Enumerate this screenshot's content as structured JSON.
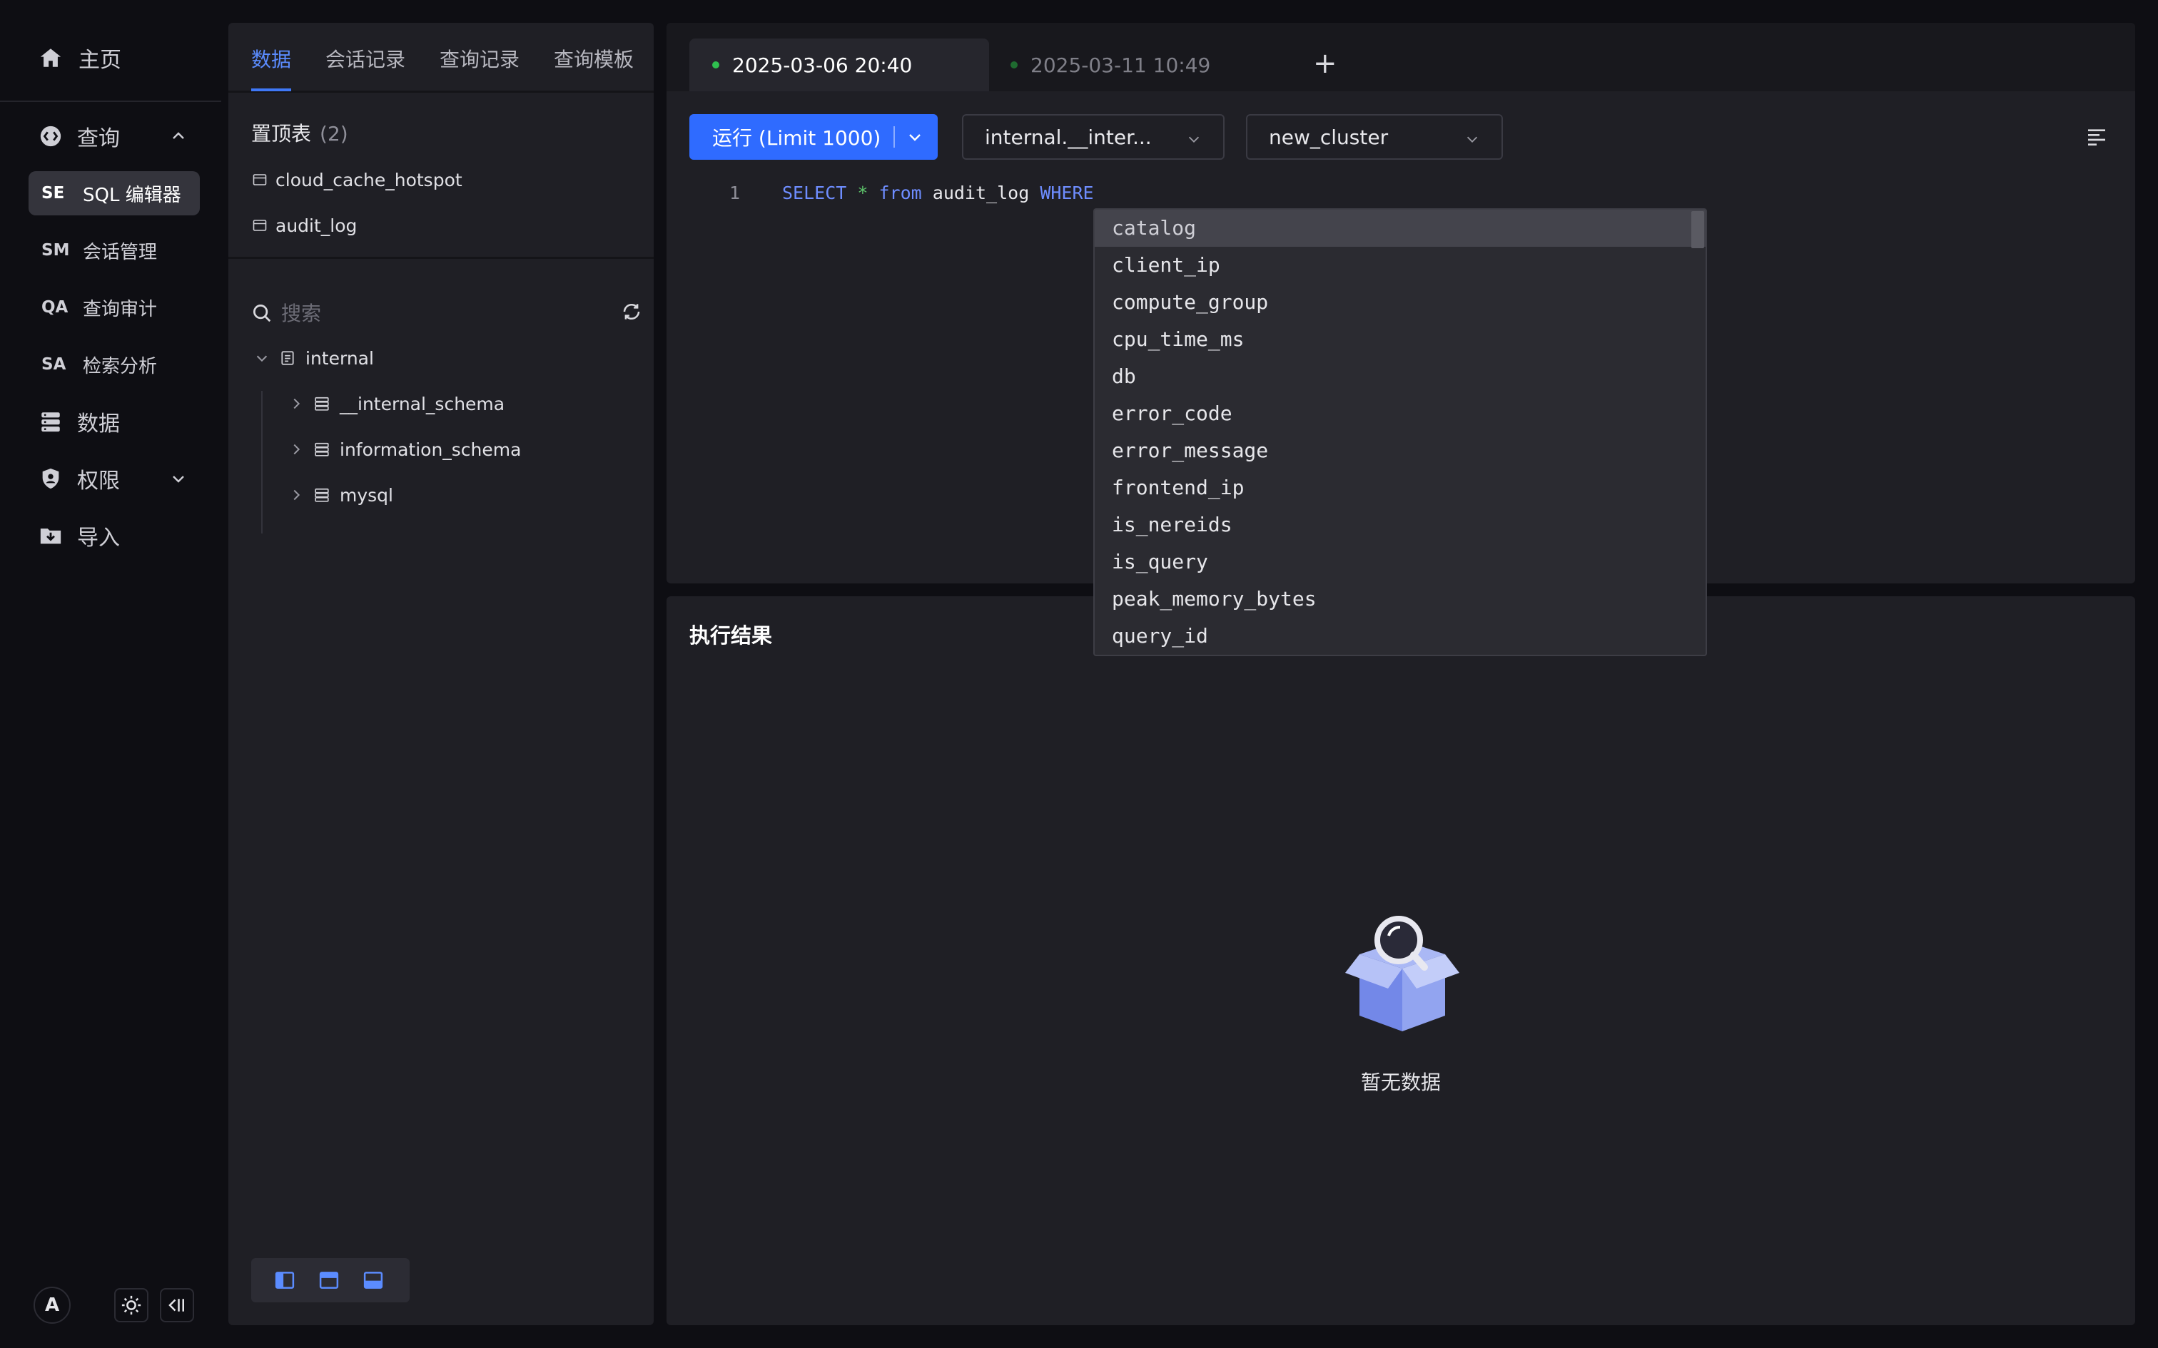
{
  "nav": {
    "home_label": "主页",
    "query_label": "查询",
    "sub_items": [
      {
        "abbr": "SE",
        "label": "SQL 编辑器",
        "active": true
      },
      {
        "abbr": "SM",
        "label": "会话管理",
        "active": false
      },
      {
        "abbr": "QA",
        "label": "查询审计",
        "active": false
      },
      {
        "abbr": "SA",
        "label": "检索分析",
        "active": false
      }
    ],
    "data_label": "数据",
    "permission_label": "权限",
    "import_label": "导入",
    "avatar_letter": "A"
  },
  "explorer": {
    "tabs": [
      "数据",
      "会话记录",
      "查询记录",
      "查询模板"
    ],
    "pinned_title": "置顶表",
    "pinned_count": "(2)",
    "pinned_tables": [
      "cloud_cache_hotspot",
      "audit_log"
    ],
    "search_placeholder": "搜索",
    "catalog": "internal",
    "databases": [
      "__internal_schema",
      "information_schema",
      "mysql"
    ]
  },
  "editor": {
    "tabs": [
      {
        "label": "2025-03-06 20:40",
        "active": true,
        "dot_color": "#2fbf4f"
      },
      {
        "label": "2025-03-11 10:49",
        "active": false,
        "dot_color": "#1f6b30"
      }
    ],
    "add_tab": "+",
    "run_label": "运行 (Limit 1000)",
    "database_select": "internal.__inter...",
    "cluster_select": "new_cluster",
    "line_number": "1",
    "code_tokens": {
      "select": "SELECT",
      "star": "*",
      "from": "from",
      "table": "audit_log",
      "where": "WHERE"
    }
  },
  "autocomplete": [
    "catalog",
    "client_ip",
    "compute_group",
    "cpu_time_ms",
    "db",
    "error_code",
    "error_message",
    "frontend_ip",
    "is_nereids",
    "is_query",
    "peak_memory_bytes",
    "query_id"
  ],
  "results": {
    "title": "执行结果",
    "empty_text": "暂无数据"
  },
  "colors": {
    "accent": "#2f6bff",
    "active_tab_text": "#5b8cff",
    "keyword": "#6e8dff",
    "operator": "#5ec46b"
  }
}
